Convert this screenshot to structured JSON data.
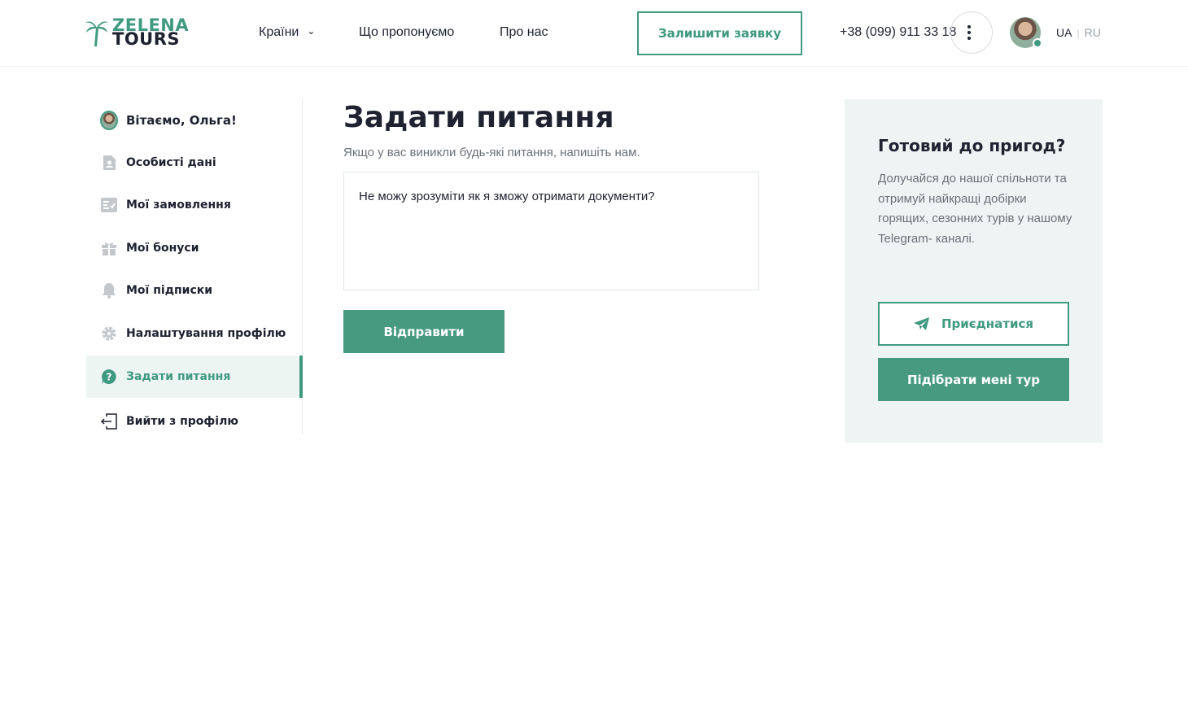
{
  "header": {
    "logo": {
      "line1": "ZELENA",
      "line2": "TOURS"
    },
    "nav": [
      {
        "label": "Країни",
        "has_dropdown": true
      },
      {
        "label": "Що пропонуємо",
        "has_dropdown": false
      },
      {
        "label": "Про нас",
        "has_dropdown": false
      }
    ],
    "cta_label": "Залишити заявку",
    "phone": "+38 (099) 911 33 18",
    "lang": {
      "active": "UA",
      "separator": "|",
      "inactive": "RU"
    }
  },
  "sidebar": {
    "items": [
      {
        "label": "Вітаємо, Ольга!",
        "icon": "avatar-icon",
        "active": false
      },
      {
        "label": "Особисті дані",
        "icon": "document-user-icon",
        "active": false
      },
      {
        "label": "Мої замовлення",
        "icon": "orders-list-icon",
        "active": false
      },
      {
        "label": "Мої бонуси",
        "icon": "gift-icon",
        "active": false
      },
      {
        "label": "Мої підписки",
        "icon": "bell-icon",
        "active": false
      },
      {
        "label": "Налаштування профілю",
        "icon": "gear-icon",
        "active": false
      },
      {
        "label": "Задати питання",
        "icon": "question-icon",
        "active": true
      },
      {
        "label": "Вийти з профілю",
        "icon": "logout-icon",
        "active": false
      }
    ]
  },
  "main": {
    "title": "Задати питання",
    "subtitle": "Якщо у вас виникли будь-які питання, напишіть нам.",
    "question_value": "Не можу зрозуміти як я зможу отримати документи?",
    "submit_label": "Відправити"
  },
  "promo": {
    "title": "Готовий до пригод?",
    "text": "Долучайся до нашої спільноти та отримуй найкращі добірки горящих, сезонних турів у нашому Telegram- каналі.",
    "join_label": "Приєднатися",
    "pick_label": "Підібрати мені тур"
  },
  "colors": {
    "accent": "#3f9a80",
    "accent_fill": "#479a80",
    "text": "#1f2230",
    "muted": "#6b7078",
    "panel": "#eef4f3",
    "active_row": "#edf5f3"
  }
}
